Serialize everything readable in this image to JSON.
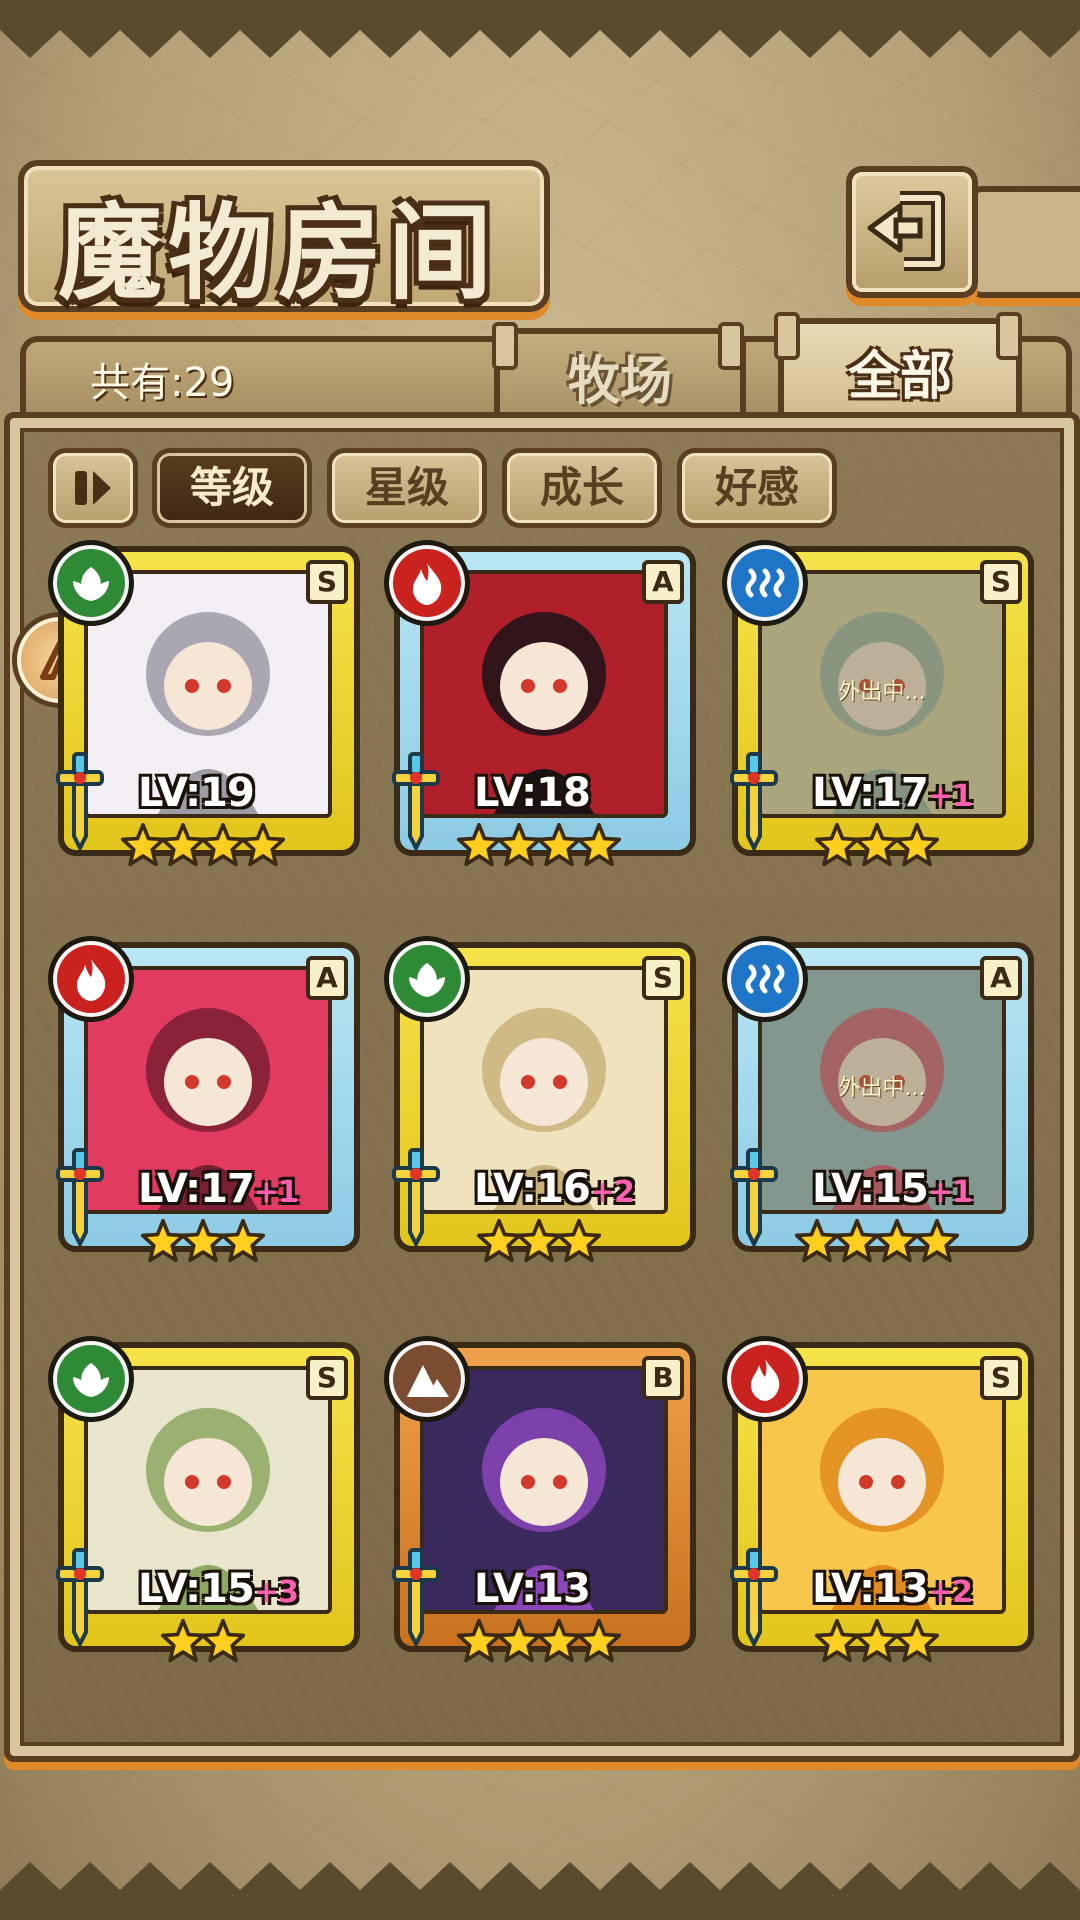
{
  "screen": {
    "title": "魔物房间"
  },
  "header": {
    "count_text": "共有:29"
  },
  "tabs": [
    {
      "label": "牧场",
      "active": false
    },
    {
      "label": "全部",
      "active": true
    }
  ],
  "sort": {
    "buttons": [
      {
        "label": "等级",
        "active": true
      },
      {
        "label": "星级",
        "active": false
      },
      {
        "label": "成长",
        "active": false
      },
      {
        "label": "好感",
        "active": false
      }
    ]
  },
  "status_text": "外出中...",
  "colors": {
    "accent_orange": "#e0892b",
    "frame_dark": "#5a3e22",
    "plus_pink": "#ff5fb1"
  },
  "monsters": [
    {
      "level": "LV:19",
      "plus": "",
      "rank": "S",
      "element": "nature",
      "stars": 4,
      "frame": "gold",
      "away": false
    },
    {
      "level": "LV:18",
      "plus": "",
      "rank": "A",
      "element": "fire",
      "stars": 4,
      "frame": "blue",
      "away": false
    },
    {
      "level": "LV:17",
      "plus": "+1",
      "rank": "S",
      "element": "water",
      "stars": 3,
      "frame": "gold",
      "away": true
    },
    {
      "level": "LV:17",
      "plus": "+1",
      "rank": "A",
      "element": "fire",
      "stars": 3,
      "frame": "blue",
      "away": false
    },
    {
      "level": "LV:16",
      "plus": "+2",
      "rank": "S",
      "element": "nature",
      "stars": 3,
      "frame": "gold",
      "away": false
    },
    {
      "level": "LV:15",
      "plus": "+1",
      "rank": "A",
      "element": "water",
      "stars": 4,
      "frame": "blue",
      "away": true
    },
    {
      "level": "LV:15",
      "plus": "+3",
      "rank": "S",
      "element": "nature",
      "stars": 2,
      "frame": "gold",
      "away": false
    },
    {
      "level": "LV:13",
      "plus": "",
      "rank": "B",
      "element": "earth",
      "stars": 4,
      "frame": "bronze",
      "away": false
    },
    {
      "level": "LV:13",
      "plus": "+2",
      "rank": "S",
      "element": "fire",
      "stars": 3,
      "frame": "gold",
      "away": false
    }
  ]
}
